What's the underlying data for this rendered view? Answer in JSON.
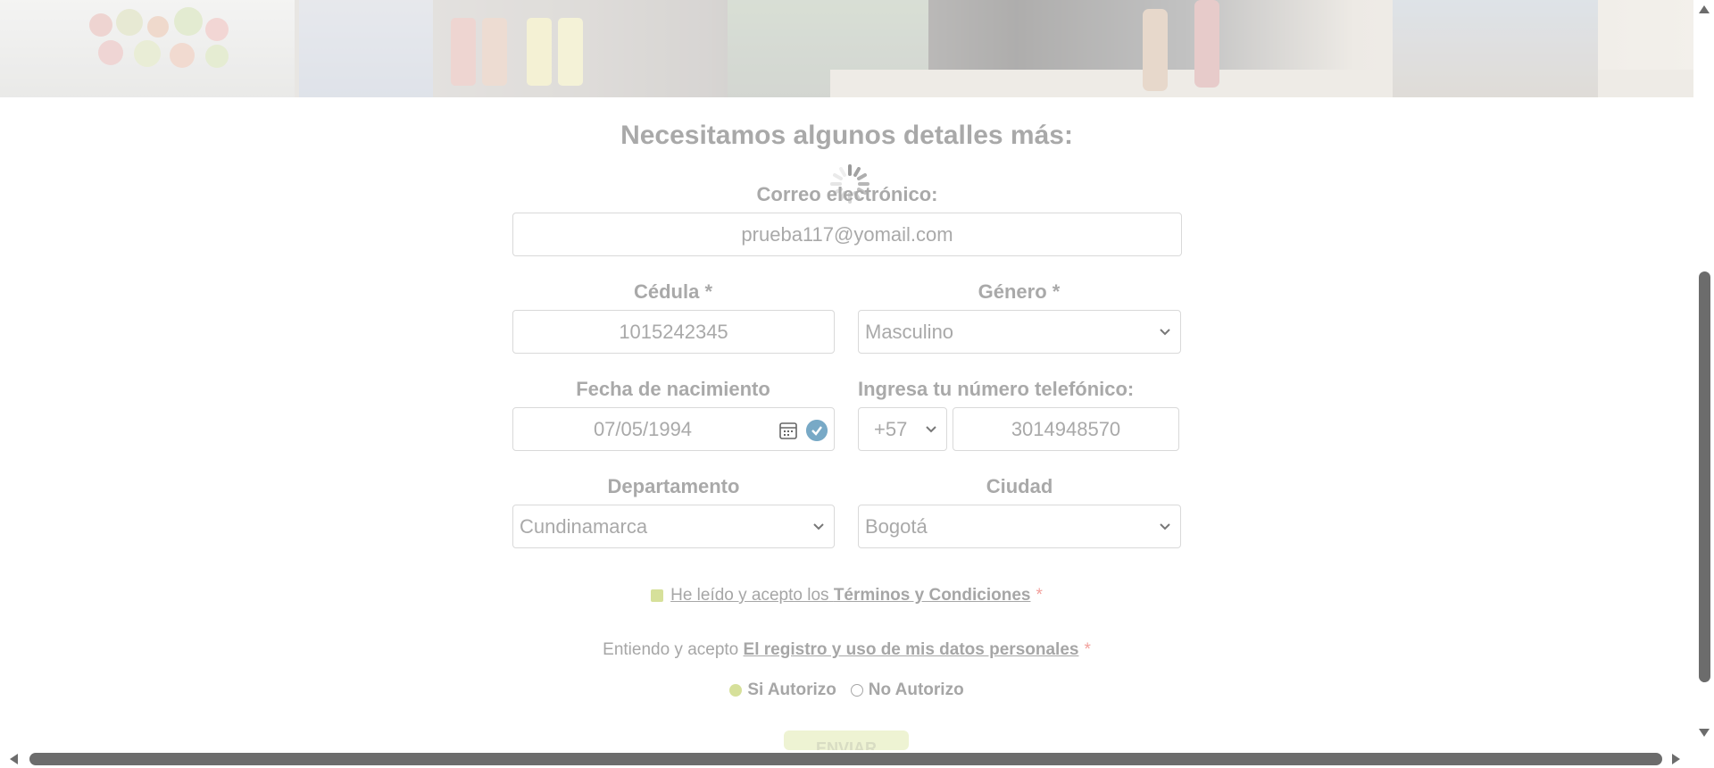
{
  "form": {
    "title": "Necesitamos algunos detalles más:",
    "email_label": "Correo electrónico:",
    "email_value": "prueba117@yomail.com",
    "cedula_label": "Cédula *",
    "cedula_value": "1015242345",
    "genero_label": "Género *",
    "genero_value": "Masculino",
    "fecha_label": "Fecha de nacimiento",
    "fecha_value": "07/05/1994",
    "telefono_label": "Ingresa tu número telefónico:",
    "country_code": "+57",
    "telefono_value": "3014948570",
    "departamento_label": "Departamento",
    "departamento_value": "Cundinamarca",
    "ciudad_label": "Ciudad",
    "ciudad_value": "Bogotá"
  },
  "terms": {
    "prefix": "He leído y acepto los",
    "link": "Términos y Condiciones",
    "required_mark": "*"
  },
  "privacy": {
    "prefix": "Entiendo y acepto",
    "link": "El registro y uso de mis datos personales",
    "required_mark": "*",
    "option_yes": "Si Autorizo",
    "option_no": "No Autorizo"
  },
  "submit": {
    "label": "ENVIAR"
  },
  "colors": {
    "text_muted": "#a9a9a9",
    "accent_green": "#d6e09a",
    "required_red": "#f2a19d",
    "check_blue": "#78a9c6"
  },
  "icons": [
    "loading-spinner-icon",
    "calendar-icon",
    "check-circle-icon",
    "chevron-down-icon"
  ]
}
